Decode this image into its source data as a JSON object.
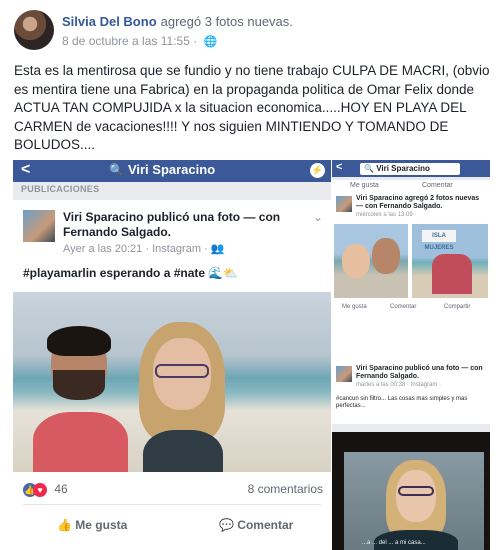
{
  "post": {
    "author": "Silvia Del Bono",
    "action": "agregó 3 fotos nuevas.",
    "timestamp": "8 de octubre a las 11:55",
    "separator": "·",
    "privacy_icon": "globe-icon",
    "text": "Esta es la mentirosa que se fundio y no tiene trabajo CULPA DE MACRI, (obvio es mentira tiene una Fabrica) en la propaganda politica de Omar Felix donde ACTUA TAN COMPUJIDA x la situacion economica.....HOY EN PLAYA DEL CARMEN de vacaciones!!!! Y nos siguien MINTIENDO Y TOMANDO DE BOLUDOS...."
  },
  "photo_left": {
    "back": "<",
    "search_text": "Viri Sparacino",
    "section_label": "PUBLICACIONES",
    "card_title": "Viri Sparacino publicó una foto — con Fernando Salgado.",
    "card_meta": "Ayer a las 20:21 · Instagram · ",
    "caption": "#playamarlin esperando a #nate 🌊⛅",
    "reaction_count": "46",
    "comments": "8 comentarios",
    "like_label": "Me gusta",
    "comment_label": "Comentar"
  },
  "photo_r1": {
    "back": "<",
    "search_text": "Viri Sparacino",
    "mini_like": "Me gusta",
    "mini_comment": "Comentar",
    "post_title": "Viri Sparacino agregó 2 fotos nuevas — con Fernando Salgado.",
    "post_time": "miércoles a las 13:09 · ",
    "sign_text": "ISLA MUJERES",
    "like_label": "Me gusta",
    "comment_label": "Comentar",
    "share_label": "Compartir"
  },
  "photo_r2": {
    "post_title": "Viri Sparacino publicó una foto — con Fernando Salgado.",
    "post_time": "martes a las 00:38 · Instagram · ",
    "text": "#cancun sin filtro... Las cosas mas simples y mas perfectas...",
    "tv_caption": "...a ... del ... a mi casa..."
  },
  "colors": {
    "facebook_blue": "#3b5998",
    "link_blue": "#365899"
  }
}
